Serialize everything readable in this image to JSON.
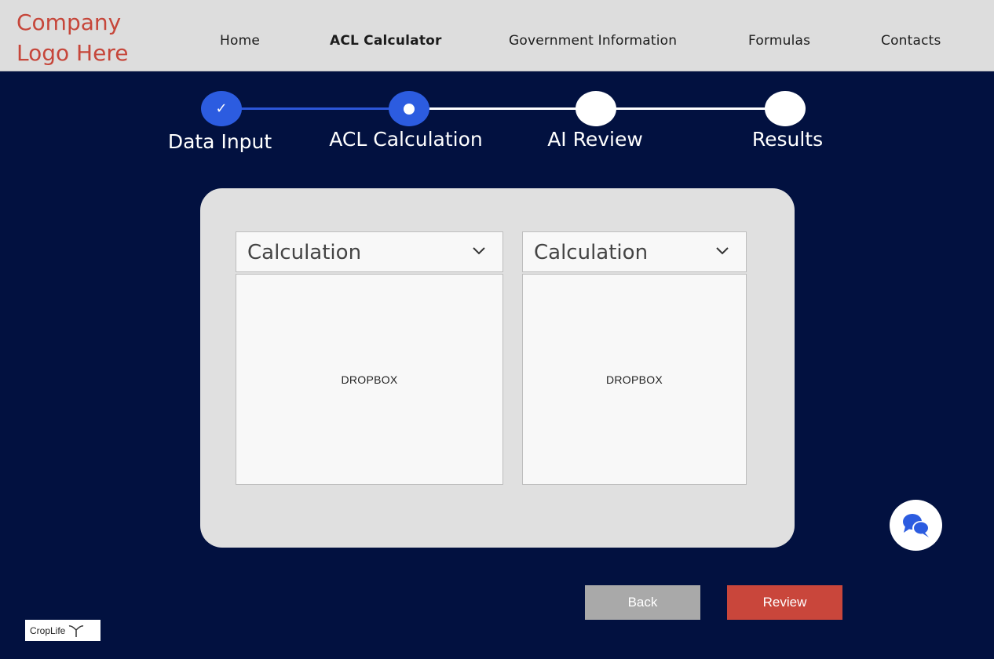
{
  "header": {
    "logo_text": "Company Logo Here",
    "nav": [
      {
        "label": "Home",
        "active": false
      },
      {
        "label": "ACL Calculator",
        "active": true
      },
      {
        "label": "Government Information",
        "active": false
      },
      {
        "label": "Formulas",
        "active": false
      },
      {
        "label": "Contacts",
        "active": false
      }
    ]
  },
  "stepper": {
    "steps": [
      {
        "label": "Data Input",
        "state": "done",
        "icon": "check-icon"
      },
      {
        "label": "ACL Calculation",
        "state": "current",
        "icon": "dot-icon"
      },
      {
        "label": "AI Review",
        "state": "pending"
      },
      {
        "label": "Results",
        "state": "pending"
      }
    ]
  },
  "panels": [
    {
      "select_value": "Calculation",
      "dropbox_label": "DROPBOX"
    },
    {
      "select_value": "Calculation",
      "dropbox_label": "DROPBOX"
    }
  ],
  "actions": {
    "back_label": "Back",
    "review_label": "Review"
  },
  "footer": {
    "brand_text": "CropLife"
  },
  "chat": {
    "icon": "chat-bubbles-icon"
  },
  "colors": {
    "background": "#021140",
    "header": "#dddddd",
    "accent_blue": "#2c5ce0",
    "logo_red": "#c6463a",
    "review_button": "#c9463b",
    "back_button": "#a9a9a9"
  }
}
